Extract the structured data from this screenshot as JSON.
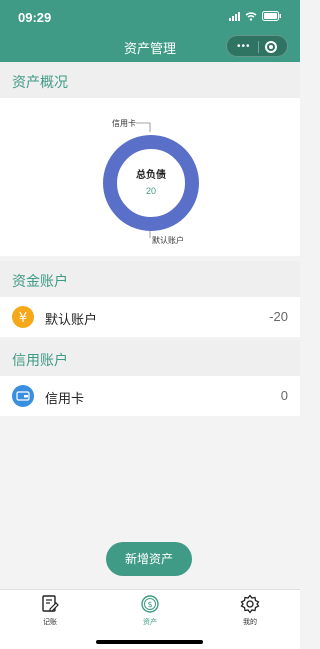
{
  "status_bar": {
    "time": "09:29"
  },
  "nav": {
    "title": "资产管理"
  },
  "overview": {
    "title": "资产概况",
    "donut_center_label": "总负债",
    "donut_center_value": "20",
    "callouts": [
      "信用卡",
      "默认账户"
    ],
    "donut_color": "#5a6fc8"
  },
  "fund_accounts": {
    "title": "资金账户",
    "items": [
      {
        "label": "默认账户",
        "amount": "-20",
        "icon": "yuan-icon"
      }
    ]
  },
  "credit_accounts": {
    "title": "信用账户",
    "items": [
      {
        "label": "信用卡",
        "amount": "0",
        "icon": "card-icon"
      }
    ]
  },
  "actions": {
    "add_asset": "新增资产"
  },
  "tabbar": {
    "tabs": [
      {
        "label": "记账"
      },
      {
        "label": "资产"
      },
      {
        "label": "我的"
      }
    ]
  },
  "colors": {
    "accent": "#3f9b85",
    "yuan": "#f4a81a",
    "card": "#3a8ee0"
  }
}
